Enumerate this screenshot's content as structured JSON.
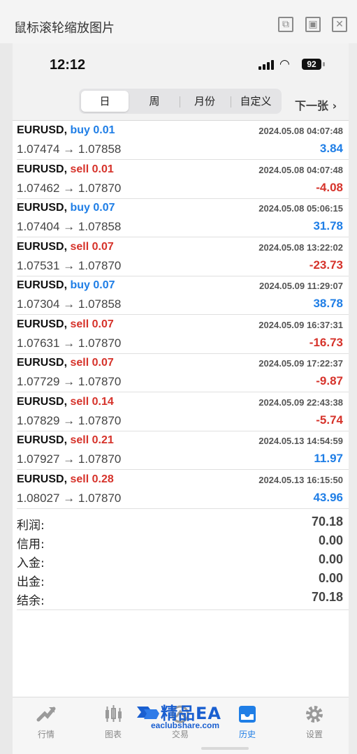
{
  "viewer": {
    "title": "鼠标滚轮缩放图片",
    "buttons": {
      "open_external": "⧉",
      "fit": "▣",
      "close": "✕"
    }
  },
  "status_bar": {
    "time": "12:12",
    "battery": "92"
  },
  "period_tabs": [
    {
      "label": "日",
      "active": true
    },
    {
      "label": "周",
      "active": false
    },
    {
      "label": "月份",
      "active": false
    },
    {
      "label": "自定义",
      "active": false
    }
  ],
  "next_label": "下一张 ›",
  "deals": [
    {
      "symbol": "EURUSD,",
      "side": "buy",
      "volume": "buy 0.01",
      "time": "2024.05.08 04:07:48",
      "prices": "1.07474 → 1.07858",
      "profit": "3.84"
    },
    {
      "symbol": "EURUSD,",
      "side": "sell",
      "volume": "sell 0.01",
      "time": "2024.05.08 04:07:48",
      "prices": "1.07462 → 1.07870",
      "profit": "-4.08"
    },
    {
      "symbol": "EURUSD,",
      "side": "buy",
      "volume": "buy 0.07",
      "time": "2024.05.08 05:06:15",
      "prices": "1.07404 → 1.07858",
      "profit": "31.78"
    },
    {
      "symbol": "EURUSD,",
      "side": "sell",
      "volume": "sell 0.07",
      "time": "2024.05.08 13:22:02",
      "prices": "1.07531 → 1.07870",
      "profit": "-23.73"
    },
    {
      "symbol": "EURUSD,",
      "side": "buy",
      "volume": "buy 0.07",
      "time": "2024.05.09 11:29:07",
      "prices": "1.07304 → 1.07858",
      "profit": "38.78"
    },
    {
      "symbol": "EURUSD,",
      "side": "sell",
      "volume": "sell 0.07",
      "time": "2024.05.09 16:37:31",
      "prices": "1.07631 → 1.07870",
      "profit": "-16.73"
    },
    {
      "symbol": "EURUSD,",
      "side": "sell",
      "volume": "sell 0.07",
      "time": "2024.05.09 17:22:37",
      "prices": "1.07729 → 1.07870",
      "profit": "-9.87"
    },
    {
      "symbol": "EURUSD,",
      "side": "sell",
      "volume": "sell 0.14",
      "time": "2024.05.09 22:43:38",
      "prices": "1.07829 → 1.07870",
      "profit": "-5.74"
    },
    {
      "symbol": "EURUSD,",
      "side": "sell",
      "volume": "sell 0.21",
      "time": "2024.05.13 14:54:59",
      "prices": "1.07927 → 1.07870",
      "profit": "11.97"
    },
    {
      "symbol": "EURUSD,",
      "side": "sell",
      "volume": "sell 0.28",
      "time": "2024.05.13 16:15:50",
      "prices": "1.08027 → 1.07870",
      "profit": "43.96"
    }
  ],
  "summary": [
    {
      "label": "利润:",
      "value": "70.18"
    },
    {
      "label": "信用:",
      "value": "0.00"
    },
    {
      "label": "入金:",
      "value": "0.00"
    },
    {
      "label": "出金:",
      "value": "0.00"
    },
    {
      "label": "结余:",
      "value": "70.18"
    }
  ],
  "bottom_nav": [
    {
      "label": "行情",
      "icon": "quotes-icon",
      "active": false
    },
    {
      "label": "图表",
      "icon": "chart-icon",
      "active": false
    },
    {
      "label": "交易",
      "icon": "trade-icon",
      "active": false
    },
    {
      "label": "历史",
      "icon": "history-icon",
      "active": true
    },
    {
      "label": "设置",
      "icon": "settings-icon",
      "active": false
    }
  ],
  "watermark": {
    "title": "精品EA",
    "subtitle": "eaclubshare.com"
  },
  "colors": {
    "buy": "#1f7ee6",
    "sell": "#d6332b",
    "active_nav": "#1f7ee6"
  }
}
